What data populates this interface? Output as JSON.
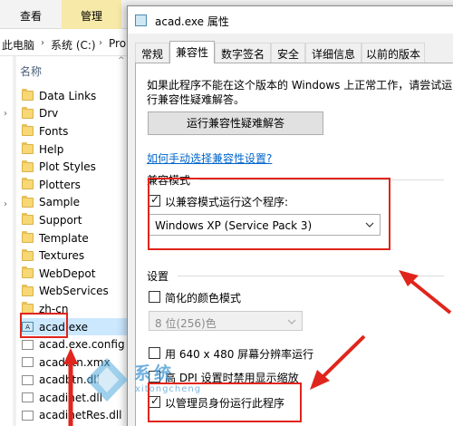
{
  "explorer": {
    "ribbon_tabs": [
      "查看",
      "管理"
    ],
    "breadcrumb": [
      "此电脑",
      "系统 (C:)",
      "Pro"
    ],
    "column_header": "名称",
    "files": [
      {
        "name": "Data Links",
        "type": "folder"
      },
      {
        "name": "Drv",
        "type": "folder"
      },
      {
        "name": "Fonts",
        "type": "folder"
      },
      {
        "name": "Help",
        "type": "folder"
      },
      {
        "name": "Plot Styles",
        "type": "folder"
      },
      {
        "name": "Plotters",
        "type": "folder"
      },
      {
        "name": "Sample",
        "type": "folder"
      },
      {
        "name": "Support",
        "type": "folder"
      },
      {
        "name": "Template",
        "type": "folder"
      },
      {
        "name": "Textures",
        "type": "folder"
      },
      {
        "name": "WebDepot",
        "type": "folder"
      },
      {
        "name": "WebServices",
        "type": "folder"
      },
      {
        "name": "zh-cn",
        "type": "folder"
      },
      {
        "name": "acad.exe",
        "type": "exe"
      },
      {
        "name": "acad.exe.config",
        "type": "file"
      },
      {
        "name": "acadbtn.xmx",
        "type": "file"
      },
      {
        "name": "acadbtn.dll",
        "type": "file"
      },
      {
        "name": "acadinet.dll",
        "type": "file"
      },
      {
        "name": "acadinetRes.dll",
        "type": "file"
      }
    ]
  },
  "dialog": {
    "title": "acad.exe 属性",
    "tabs": [
      "常规",
      "兼容性",
      "数字签名",
      "安全",
      "详细信息",
      "以前的版本"
    ],
    "active_tab": "兼容性",
    "description": "如果此程序不能在这个版本的 Windows 上正常工作，请尝试运行兼容性疑难解答。",
    "troubleshoot_button": "运行兼容性疑难解答",
    "manual_link": "如何手动选择兼容性设置?",
    "compat_mode": {
      "group_label": "兼容模式",
      "checkbox_label": "以兼容模式运行这个程序:",
      "checked": true,
      "selected_os": "Windows XP (Service Pack 3)"
    },
    "settings": {
      "group_label": "设置",
      "reduced_color_label": "简化的颜色模式",
      "reduced_color_checked": false,
      "color_depth": "8 位(256)色",
      "resolution_label": "用 640 x 480 屏幕分辨率运行",
      "resolution_checked": false,
      "dpi_label": "高 DPI 设置时禁用显示缩放",
      "dpi_checked": false,
      "admin_label": "以管理员身份运行此程序",
      "admin_checked": true
    }
  },
  "watermark": {
    "text": "系统",
    "sub": "xitongcheng"
  },
  "colors": {
    "annotation_red": "#e0251c",
    "selection_blue": "#cce8ff",
    "link_blue": "#0066cc"
  }
}
